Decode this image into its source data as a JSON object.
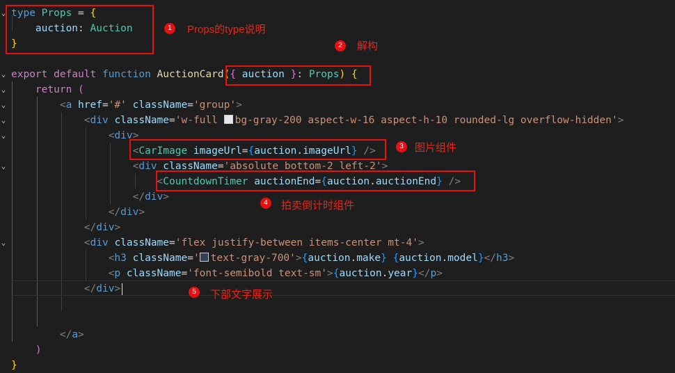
{
  "editor": {
    "lines": [
      {
        "fold": "⌄",
        "tokens": [
          {
            "c": "kw",
            "t": "type"
          },
          {
            "c": "txt",
            "t": " "
          },
          {
            "c": "type",
            "t": "Props"
          },
          {
            "c": "txt",
            "t": " = "
          },
          {
            "c": "br1",
            "t": "{"
          }
        ]
      },
      {
        "fold": "",
        "tokens": [
          {
            "c": "txt",
            "t": "    "
          },
          {
            "c": "var",
            "t": "auction"
          },
          {
            "c": "txt",
            "t": ": "
          },
          {
            "c": "type",
            "t": "Auction"
          }
        ]
      },
      {
        "fold": "",
        "tokens": [
          {
            "c": "br1",
            "t": "}"
          }
        ]
      },
      {
        "fold": "",
        "tokens": []
      },
      {
        "fold": "⌄",
        "tokens": [
          {
            "c": "ctrl",
            "t": "export"
          },
          {
            "c": "txt",
            "t": " "
          },
          {
            "c": "ctrl",
            "t": "default"
          },
          {
            "c": "txt",
            "t": " "
          },
          {
            "c": "kw",
            "t": "function"
          },
          {
            "c": "txt",
            "t": " "
          },
          {
            "c": "fn",
            "t": "AuctionCard"
          },
          {
            "c": "br1",
            "t": "("
          },
          {
            "c": "br2",
            "t": "{"
          },
          {
            "c": "txt",
            "t": " "
          },
          {
            "c": "var",
            "t": "auction"
          },
          {
            "c": "txt",
            "t": " "
          },
          {
            "c": "br2",
            "t": "}"
          },
          {
            "c": "txt",
            "t": ": "
          },
          {
            "c": "type",
            "t": "Props"
          },
          {
            "c": "br1",
            "t": ")"
          },
          {
            "c": "txt",
            "t": " "
          },
          {
            "c": "br1",
            "t": "{"
          }
        ]
      },
      {
        "fold": "⌄",
        "tokens": [
          {
            "c": "txt",
            "t": "    "
          },
          {
            "c": "ctrl",
            "t": "return"
          },
          {
            "c": "txt",
            "t": " "
          },
          {
            "c": "br2",
            "t": "("
          }
        ]
      },
      {
        "fold": "⌄",
        "tokens": [
          {
            "c": "txt",
            "t": "        "
          },
          {
            "c": "punc",
            "t": "<"
          },
          {
            "c": "tag",
            "t": "a"
          },
          {
            "c": "txt",
            "t": " "
          },
          {
            "c": "var",
            "t": "href"
          },
          {
            "c": "txt",
            "t": "="
          },
          {
            "c": "str",
            "t": "'#'"
          },
          {
            "c": "txt",
            "t": " "
          },
          {
            "c": "var",
            "t": "className"
          },
          {
            "c": "txt",
            "t": "="
          },
          {
            "c": "str",
            "t": "'group'"
          },
          {
            "c": "punc",
            "t": ">"
          }
        ]
      },
      {
        "fold": "⌄",
        "tokens": [
          {
            "c": "txt",
            "t": "            "
          },
          {
            "c": "punc",
            "t": "<"
          },
          {
            "c": "tag",
            "t": "div"
          },
          {
            "c": "txt",
            "t": " "
          },
          {
            "c": "var",
            "t": "className"
          },
          {
            "c": "txt",
            "t": "="
          },
          {
            "c": "str",
            "t": "'w-full "
          },
          {
            "c": "swatch",
            "t": "#e5e7eb"
          },
          {
            "c": "str",
            "t": "bg-gray-200 aspect-w-16 aspect-h-10 rounded-lg overflow-hidden'"
          },
          {
            "c": "punc",
            "t": ">"
          }
        ]
      },
      {
        "fold": "⌄",
        "tokens": [
          {
            "c": "txt",
            "t": "                "
          },
          {
            "c": "punc",
            "t": "<"
          },
          {
            "c": "tag",
            "t": "div"
          },
          {
            "c": "punc",
            "t": ">"
          }
        ]
      },
      {
        "fold": "",
        "tokens": [
          {
            "c": "txt",
            "t": "                    "
          },
          {
            "c": "punc",
            "t": "<"
          },
          {
            "c": "type",
            "t": "CarImage"
          },
          {
            "c": "txt",
            "t": " "
          },
          {
            "c": "var",
            "t": "imageUrl"
          },
          {
            "c": "txt",
            "t": "="
          },
          {
            "c": "br3",
            "t": "{"
          },
          {
            "c": "var",
            "t": "auction"
          },
          {
            "c": "txt",
            "t": "."
          },
          {
            "c": "var",
            "t": "imageUrl"
          },
          {
            "c": "br3",
            "t": "}"
          },
          {
            "c": "txt",
            "t": " "
          },
          {
            "c": "punc",
            "t": "/>"
          }
        ]
      },
      {
        "fold": "⌄",
        "tokens": [
          {
            "c": "txt",
            "t": "                    "
          },
          {
            "c": "punc",
            "t": "<"
          },
          {
            "c": "tag",
            "t": "div"
          },
          {
            "c": "txt",
            "t": " "
          },
          {
            "c": "var",
            "t": "className"
          },
          {
            "c": "txt",
            "t": "="
          },
          {
            "c": "str",
            "t": "'absolute bottom-2 left-2'"
          },
          {
            "c": "punc",
            "t": ">"
          }
        ]
      },
      {
        "fold": "",
        "tokens": [
          {
            "c": "txt",
            "t": "                        "
          },
          {
            "c": "punc",
            "t": "<"
          },
          {
            "c": "type",
            "t": "CountdownTimer"
          },
          {
            "c": "txt",
            "t": " "
          },
          {
            "c": "var",
            "t": "auctionEnd"
          },
          {
            "c": "txt",
            "t": "="
          },
          {
            "c": "br3",
            "t": "{"
          },
          {
            "c": "var",
            "t": "auction"
          },
          {
            "c": "txt",
            "t": "."
          },
          {
            "c": "var",
            "t": "auctionEnd"
          },
          {
            "c": "br3",
            "t": "}"
          },
          {
            "c": "txt",
            "t": " "
          },
          {
            "c": "punc",
            "t": "/>"
          }
        ]
      },
      {
        "fold": "",
        "tokens": [
          {
            "c": "txt",
            "t": "                    "
          },
          {
            "c": "punc",
            "t": "</"
          },
          {
            "c": "tag",
            "t": "div"
          },
          {
            "c": "punc",
            "t": ">"
          }
        ]
      },
      {
        "fold": "",
        "tokens": [
          {
            "c": "txt",
            "t": "                "
          },
          {
            "c": "punc",
            "t": "</"
          },
          {
            "c": "tag",
            "t": "div"
          },
          {
            "c": "punc",
            "t": ">"
          }
        ]
      },
      {
        "fold": "",
        "tokens": [
          {
            "c": "txt",
            "t": "            "
          },
          {
            "c": "punc",
            "t": "</"
          },
          {
            "c": "tag",
            "t": "div"
          },
          {
            "c": "punc",
            "t": ">"
          }
        ]
      },
      {
        "fold": "⌄",
        "tokens": [
          {
            "c": "txt",
            "t": "            "
          },
          {
            "c": "punc",
            "t": "<"
          },
          {
            "c": "tag",
            "t": "div"
          },
          {
            "c": "txt",
            "t": " "
          },
          {
            "c": "var",
            "t": "className"
          },
          {
            "c": "txt",
            "t": "="
          },
          {
            "c": "str",
            "t": "'flex justify-between items-center mt-4'"
          },
          {
            "c": "punc",
            "t": ">"
          }
        ]
      },
      {
        "fold": "",
        "tokens": [
          {
            "c": "txt",
            "t": "                "
          },
          {
            "c": "punc",
            "t": "<"
          },
          {
            "c": "tag",
            "t": "h3"
          },
          {
            "c": "txt",
            "t": " "
          },
          {
            "c": "var",
            "t": "className"
          },
          {
            "c": "txt",
            "t": "="
          },
          {
            "c": "str",
            "t": "'"
          },
          {
            "c": "swatch",
            "t": "#374151"
          },
          {
            "c": "str",
            "t": "text-gray-700'"
          },
          {
            "c": "punc",
            "t": ">"
          },
          {
            "c": "br3",
            "t": "{"
          },
          {
            "c": "var",
            "t": "auction"
          },
          {
            "c": "txt",
            "t": "."
          },
          {
            "c": "var",
            "t": "make"
          },
          {
            "c": "br3",
            "t": "}"
          },
          {
            "c": "txt",
            "t": " "
          },
          {
            "c": "br3",
            "t": "{"
          },
          {
            "c": "var",
            "t": "auction"
          },
          {
            "c": "txt",
            "t": "."
          },
          {
            "c": "var",
            "t": "model"
          },
          {
            "c": "br3",
            "t": "}"
          },
          {
            "c": "punc",
            "t": "</"
          },
          {
            "c": "tag",
            "t": "h3"
          },
          {
            "c": "punc",
            "t": ">"
          }
        ]
      },
      {
        "fold": "",
        "tokens": [
          {
            "c": "txt",
            "t": "                "
          },
          {
            "c": "punc",
            "t": "<"
          },
          {
            "c": "tag",
            "t": "p"
          },
          {
            "c": "txt",
            "t": " "
          },
          {
            "c": "var",
            "t": "className"
          },
          {
            "c": "txt",
            "t": "="
          },
          {
            "c": "str",
            "t": "'font-semibold text-sm'"
          },
          {
            "c": "punc",
            "t": ">"
          },
          {
            "c": "br3",
            "t": "{"
          },
          {
            "c": "var",
            "t": "auction"
          },
          {
            "c": "txt",
            "t": "."
          },
          {
            "c": "var",
            "t": "year"
          },
          {
            "c": "br3",
            "t": "}"
          },
          {
            "c": "punc",
            "t": "</"
          },
          {
            "c": "tag",
            "t": "p"
          },
          {
            "c": "punc",
            "t": ">"
          }
        ]
      },
      {
        "fold": "",
        "tokens": [
          {
            "c": "txt",
            "t": "            "
          },
          {
            "c": "punc",
            "t": "</"
          },
          {
            "c": "tag",
            "t": "div"
          },
          {
            "c": "punc",
            "t": ">"
          }
        ]
      },
      {
        "fold": "",
        "tokens": []
      },
      {
        "fold": "",
        "tokens": []
      },
      {
        "fold": "",
        "tokens": [
          {
            "c": "txt",
            "t": "        "
          },
          {
            "c": "punc",
            "t": "</"
          },
          {
            "c": "tag",
            "t": "a"
          },
          {
            "c": "punc",
            "t": ">"
          }
        ]
      },
      {
        "fold": "",
        "tokens": [
          {
            "c": "txt",
            "t": "    "
          },
          {
            "c": "br2",
            "t": ")"
          }
        ]
      },
      {
        "fold": "",
        "tokens": [
          {
            "c": "br1",
            "t": "}"
          }
        ]
      }
    ]
  },
  "annotations": [
    {
      "num": "1",
      "label": "Props的type说明"
    },
    {
      "num": "2",
      "label": "解构"
    },
    {
      "num": "3",
      "label": "图片组件"
    },
    {
      "num": "4",
      "label": "拍卖倒计时组件"
    },
    {
      "num": "5",
      "label": "下部文字展示"
    }
  ],
  "colors": {
    "background": "#1e1e1e",
    "annotation": "#e81010"
  }
}
